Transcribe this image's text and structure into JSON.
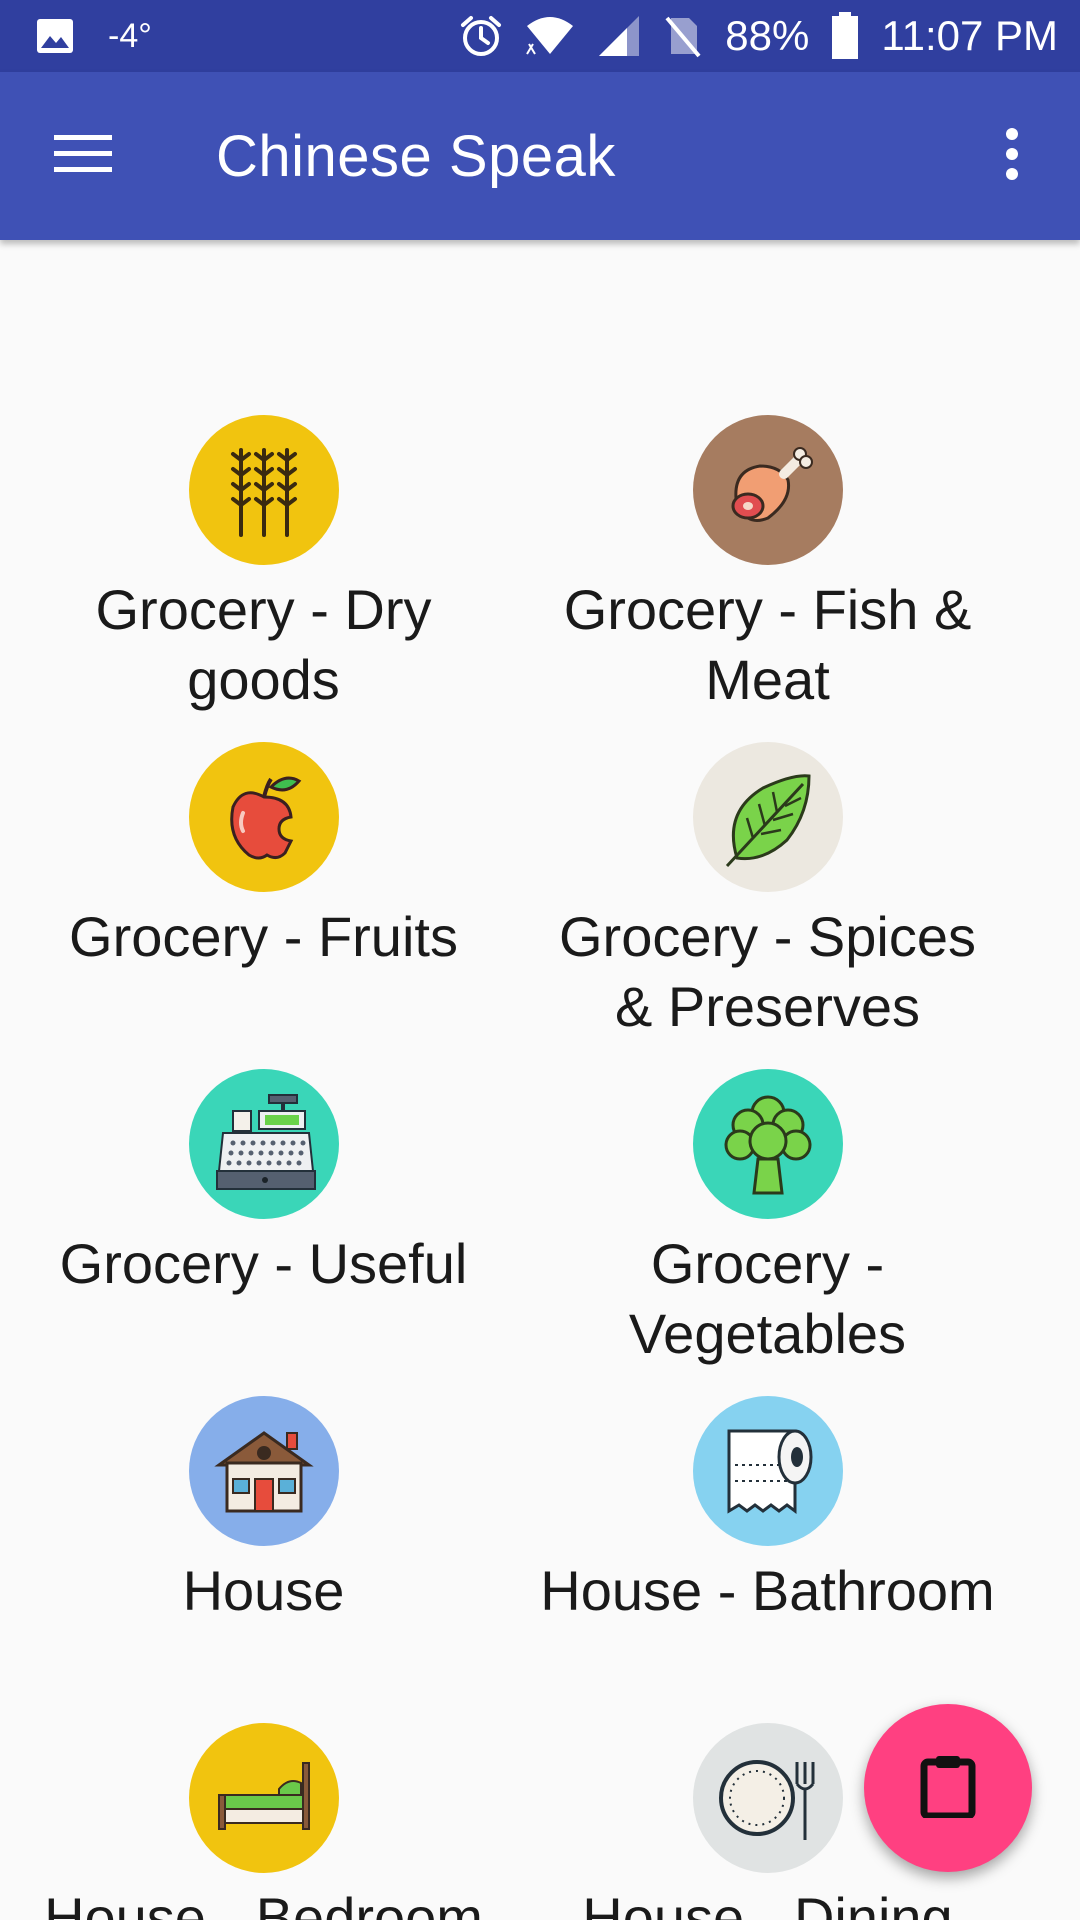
{
  "status_bar": {
    "temperature": "-4°",
    "battery": "88%",
    "time": "11:07 PM",
    "icons": [
      "image-icon",
      "alarm-icon",
      "wifi-icon",
      "signal-icon",
      "no-sim-icon",
      "battery-icon"
    ]
  },
  "app_bar": {
    "title": "Chinese Speak",
    "menu_icon": "hamburger-menu-icon",
    "overflow_icon": "more-vert-icon",
    "color": "#3f51b5"
  },
  "categories": [
    {
      "label": "Grocery - Dry goods",
      "icon": "wheat-icon",
      "color": "#f1c40f"
    },
    {
      "label": "Grocery - Fish & Meat",
      "icon": "meat-leg-icon",
      "color": "#a67c60"
    },
    {
      "label": "Grocery - Fruits",
      "icon": "apple-icon",
      "color": "#f1c40f"
    },
    {
      "label": "Grocery - Spices & Preserves",
      "icon": "leaf-icon",
      "color": "#ece8e0"
    },
    {
      "label": "Grocery - Useful",
      "icon": "cash-register-icon",
      "color": "#3ad6b8"
    },
    {
      "label": "Grocery - Vegetables",
      "icon": "broccoli-icon",
      "color": "#3ad6b8"
    },
    {
      "label": "House",
      "icon": "house-icon",
      "color": "#86aeea"
    },
    {
      "label": "House - Bathroom",
      "icon": "toilet-paper-icon",
      "color": "#86d2f0"
    },
    {
      "label": "House - Bedroom",
      "icon": "bed-icon",
      "color": "#f1c40f"
    },
    {
      "label": "House - Dining",
      "icon": "plate-fork-icon",
      "color": "#e0e3e3"
    }
  ],
  "fab": {
    "icon": "clipboard-icon",
    "color": "#ff4081"
  }
}
